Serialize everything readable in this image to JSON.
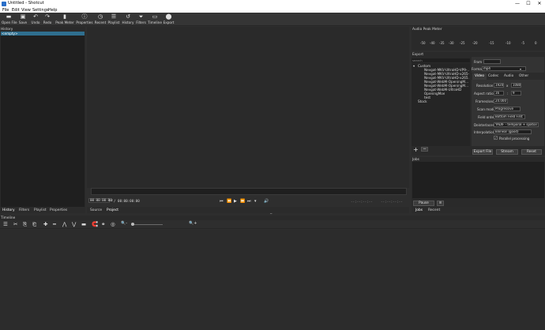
{
  "window": {
    "title": "Untitled - Shotcut",
    "minimize": "—",
    "maximize": "☐",
    "close": "✕"
  },
  "menu": [
    "File",
    "Edit",
    "View",
    "Settings",
    "Help"
  ],
  "toolbar": [
    {
      "label": "Open File",
      "icon": "▬"
    },
    {
      "label": "Save",
      "icon": "▣"
    },
    {
      "label": "Undo",
      "icon": "↶"
    },
    {
      "label": "Redo",
      "icon": "↷"
    },
    {
      "label": "Peak Meter",
      "icon": "▮"
    },
    {
      "label": "Properties",
      "icon": "ⓘ"
    },
    {
      "label": "Recent",
      "icon": "◷"
    },
    {
      "label": "Playlist",
      "icon": "☰"
    },
    {
      "label": "History",
      "icon": "↺"
    },
    {
      "label": "Filters",
      "icon": "⏷"
    },
    {
      "label": "Timeline",
      "icon": "▭"
    },
    {
      "label": "Export",
      "icon": "⬤"
    }
  ],
  "history": {
    "title": "History",
    "item": "<empty>"
  },
  "left_tabs": [
    "History",
    "Filters",
    "Playlist",
    "Properties"
  ],
  "player": {
    "position": "00:00:00:00",
    "duration": "/ 00:00:00:00",
    "in_point": "--:--:--:--",
    "out_point": "--:--:--:--",
    "tabs": [
      "Source",
      "Project"
    ]
  },
  "peak_meter": {
    "title": "Audio Peak Meter",
    "scale": [
      "-50",
      "-40",
      "-35",
      "-30",
      "-25",
      "-20",
      "-15",
      "-10",
      "-5",
      "0"
    ]
  },
  "export": {
    "title": "Export",
    "search_placeholder": "search",
    "tree": [
      "Custom",
      "Nevgat-MKV-UltraHD-VP9-...",
      "Nevgat-MKV-UltraHD-x265-...",
      "Nevgat-MKV-UltraHD-x265...",
      "Nevgat-WebM-OpeningM...",
      "Nevgat-WebM-OpeningM...",
      "Nevgat-WebM-UltraHD",
      "OpeningMoe",
      "test",
      "Stock"
    ],
    "from_label": "From",
    "from_value": "",
    "format_label": "Format",
    "format_value": "mp4",
    "tabs": [
      "Video",
      "Codec",
      "Audio",
      "Other"
    ],
    "resolution_label": "Resolution",
    "res_w": "1920",
    "res_x": "x",
    "res_h": "1080",
    "aspect_label": "Aspect ratio",
    "aspect_w": "16",
    "aspect_colon": ":",
    "aspect_h": "9",
    "framerate_label": "Frames/sec",
    "framerate_value": "24.000",
    "scan_label": "Scan mode",
    "scan_value": "Progressive",
    "field_label": "Field order",
    "field_value": "Bottom Field First",
    "deinterlacer_label": "Deinterlacer",
    "deinterlacer_value": "YADIF - temporal + spatial",
    "interp_label": "Interpolation",
    "interp_value": "Bilinear (good)",
    "parallel_label": "Parallel processing",
    "btn_export": "Export File",
    "btn_stream": "Stream",
    "btn_reset": "Reset",
    "add": "+",
    "remove": "−"
  },
  "jobs": {
    "title": "Jobs",
    "pause": "Pause",
    "menu": "≡",
    "tabs": [
      "Jobs",
      "Recent"
    ]
  },
  "timeline": {
    "title": "Timeline",
    "tools": [
      "☰",
      "✂",
      "⎘",
      "⎗",
      "✚",
      "━",
      "⋀",
      "⋁",
      "▬",
      "🧲",
      "⚭",
      "◎",
      "🔍-",
      "🔍+"
    ]
  },
  "colors": {
    "accent": "#2f6f8f",
    "bg": "#2e2e2e"
  }
}
